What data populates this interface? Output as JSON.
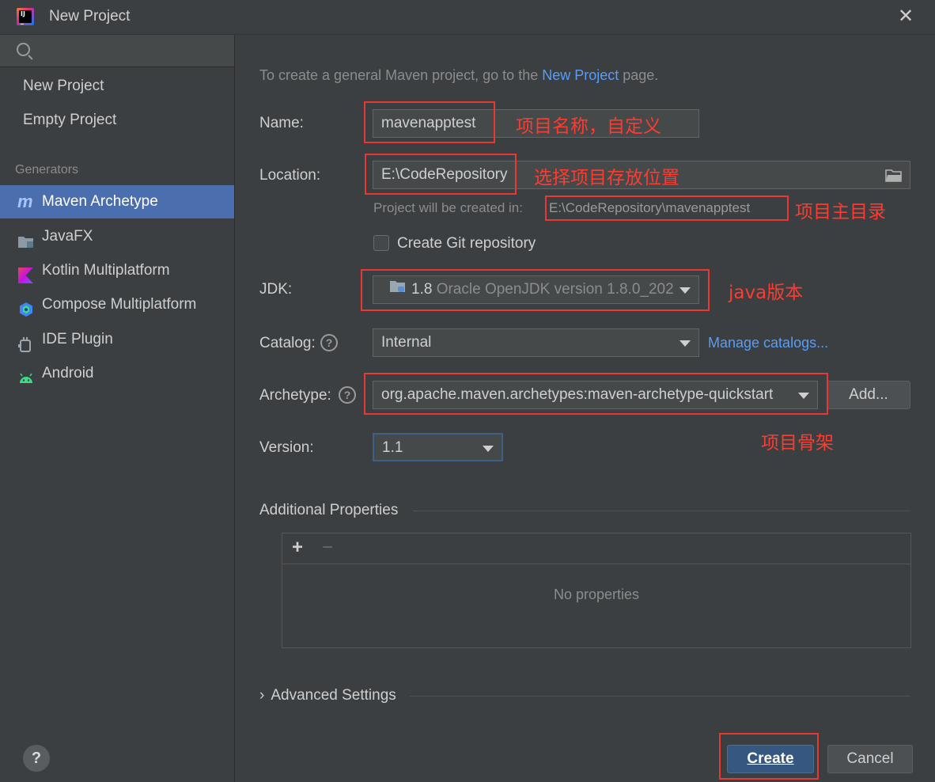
{
  "window": {
    "title": "New Project"
  },
  "sidebar": {
    "search_placeholder": "",
    "top_items": [
      {
        "label": "New Project"
      },
      {
        "label": "Empty Project"
      }
    ],
    "generators_label": "Generators",
    "generators": [
      {
        "label": "Maven Archetype",
        "icon": "maven-icon",
        "selected": true
      },
      {
        "label": "JavaFX",
        "icon": "javafx-folder-icon"
      },
      {
        "label": "Kotlin Multiplatform",
        "icon": "kotlin-icon"
      },
      {
        "label": "Compose Multiplatform",
        "icon": "compose-icon"
      },
      {
        "label": "IDE Plugin",
        "icon": "plugin-icon"
      },
      {
        "label": "Android",
        "icon": "android-icon"
      }
    ]
  },
  "main": {
    "intro_prefix": "To create a general Maven project, go to the ",
    "intro_link": "New Project",
    "intro_suffix": " page.",
    "name_label": "Name:",
    "name_value": "mavenapptest",
    "location_label": "Location:",
    "location_value": "E:\\CodeRepository",
    "created_in_prefix": "Project will be created in:",
    "created_in_path": "E:\\CodeRepository\\mavenapptest",
    "git_label": "Create Git repository",
    "jdk_label": "JDK:",
    "jdk_version": "1.8",
    "jdk_desc": "Oracle OpenJDK version 1.8.0_202",
    "catalog_label": "Catalog:",
    "catalog_value": "Internal",
    "manage_catalogs": "Manage catalogs...",
    "archetype_label": "Archetype:",
    "archetype_value": "org.apache.maven.archetypes:maven-archetype-quickstart",
    "add_button": "Add...",
    "version_label": "Version:",
    "version_value": "1.1",
    "additional_properties": "Additional Properties",
    "add_icon": "+",
    "remove_icon": "−",
    "no_properties": "No properties",
    "advanced_settings": "Advanced Settings"
  },
  "annotations": {
    "name": "项目名称，自定义",
    "location": "选择项目存放位置",
    "main_dir": "项目主目录",
    "java_version": "java版本",
    "archetype": "项目骨架"
  },
  "footer": {
    "help": "?",
    "create_button": "Create",
    "cancel_button": "Cancel"
  },
  "colors": {
    "background": "#3c3f41",
    "selection": "#4b6eaf",
    "link": "#589df6",
    "annotation": "#ff3b30"
  }
}
